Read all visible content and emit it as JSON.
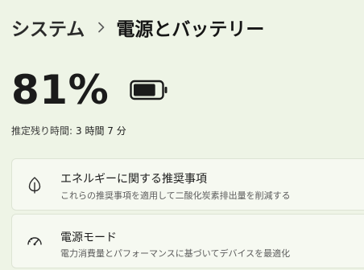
{
  "breadcrumb": {
    "parent": "システム",
    "current": "電源とバッテリー"
  },
  "battery": {
    "percent_text": "81%",
    "level_percent": 81
  },
  "remaining": {
    "label": "推定残り時間:",
    "value": "3 時間 7 分"
  },
  "cards": {
    "energy": {
      "title": "エネルギーに関する推奨事項",
      "subtitle": "これらの推奨事項を適用して二酸化炭素排出量を削減する",
      "icon": "leaf-icon"
    },
    "power_mode": {
      "title": "電源モード",
      "subtitle": "電力消費量とパフォーマンスに基づいてデバイスを最適化",
      "icon": "gauge-icon"
    }
  },
  "colors": {
    "background": "#eef4e6",
    "card_background": "#f6f9f1",
    "card_border": "#dde4d4",
    "text_primary": "#1b1b1b",
    "text_secondary": "#5c5c5c"
  }
}
